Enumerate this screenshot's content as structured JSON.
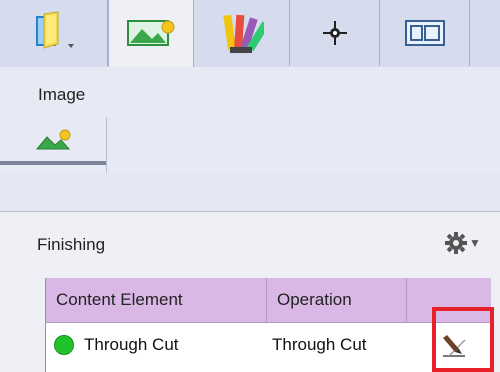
{
  "tabs": [
    {
      "id": "book",
      "icon": "book-icon"
    },
    {
      "id": "image",
      "icon": "image-icon",
      "active": true
    },
    {
      "id": "swatches",
      "icon": "color-swatch-icon"
    },
    {
      "id": "position",
      "icon": "crosshair-icon"
    },
    {
      "id": "layout",
      "icon": "layout-icon"
    }
  ],
  "section": {
    "label": "Image",
    "subtab_icon": "image-small-icon"
  },
  "finishing": {
    "title": "Finishing",
    "settings_icon": "gear-icon",
    "columns": [
      "Content Element",
      "Operation"
    ],
    "rows": [
      {
        "status_color": "#22c22a",
        "element": "Through Cut",
        "operation": "Through Cut",
        "action_icon": "edit-icon"
      }
    ]
  },
  "colors": {
    "header": "#d9b8e6",
    "highlight": "#e8202a",
    "status_green": "#22c22a"
  }
}
